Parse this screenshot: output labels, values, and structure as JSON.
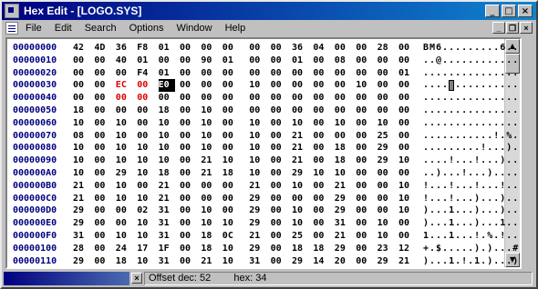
{
  "window": {
    "title": "Hex Edit - [LOGO.SYS]"
  },
  "titlebar_buttons": {
    "minimize": "_",
    "maximize": "□",
    "close": "×"
  },
  "menu": [
    "File",
    "Edit",
    "Search",
    "Options",
    "Window",
    "Help"
  ],
  "mdi_buttons": {
    "minimize": "_",
    "restore": "❐",
    "close": "×"
  },
  "hex_rows": [
    {
      "offset": "00000000",
      "bytes": [
        "42",
        "4D",
        "36",
        "F8",
        "01",
        "00",
        "00",
        "00",
        "00",
        "00",
        "36",
        "04",
        "00",
        "00",
        "28",
        "00"
      ],
      "ascii": "BM6.........6...(."
    },
    {
      "offset": "00000010",
      "bytes": [
        "00",
        "00",
        "40",
        "01",
        "00",
        "00",
        "90",
        "01",
        "00",
        "00",
        "01",
        "00",
        "08",
        "00",
        "00",
        "00"
      ],
      "ascii": "..@............."
    },
    {
      "offset": "00000020",
      "bytes": [
        "00",
        "00",
        "00",
        "F4",
        "01",
        "00",
        "00",
        "00",
        "00",
        "00",
        "00",
        "00",
        "00",
        "00",
        "00",
        "01"
      ],
      "ascii": "................"
    },
    {
      "offset": "00000030",
      "bytes": [
        "00",
        "00",
        "EC",
        "00",
        "E0",
        "00",
        "00",
        "00",
        "10",
        "00",
        "00",
        "00",
        "00",
        "10",
        "00",
        "00"
      ],
      "ascii": "................"
    },
    {
      "offset": "00000040",
      "bytes": [
        "00",
        "00",
        "00",
        "00",
        "00",
        "00",
        "00",
        "00",
        "00",
        "00",
        "00",
        "00",
        "00",
        "00",
        "00",
        "00"
      ],
      "ascii": "................"
    },
    {
      "offset": "00000050",
      "bytes": [
        "18",
        "00",
        "00",
        "00",
        "18",
        "00",
        "10",
        "00",
        "00",
        "00",
        "00",
        "00",
        "00",
        "00",
        "00",
        "00"
      ],
      "ascii": "................"
    },
    {
      "offset": "00000060",
      "bytes": [
        "10",
        "00",
        "10",
        "00",
        "10",
        "00",
        "10",
        "00",
        "10",
        "00",
        "10",
        "00",
        "10",
        "00",
        "10",
        "00"
      ],
      "ascii": "................"
    },
    {
      "offset": "00000070",
      "bytes": [
        "08",
        "00",
        "10",
        "00",
        "10",
        "00",
        "10",
        "00",
        "10",
        "00",
        "21",
        "00",
        "00",
        "00",
        "25",
        "00"
      ],
      "ascii": "...........!.%."
    },
    {
      "offset": "00000080",
      "bytes": [
        "10",
        "00",
        "10",
        "10",
        "10",
        "00",
        "10",
        "00",
        "10",
        "00",
        "21",
        "00",
        "18",
        "00",
        "29",
        "00"
      ],
      "ascii": ".........!...).."
    },
    {
      "offset": "00000090",
      "bytes": [
        "10",
        "00",
        "10",
        "10",
        "10",
        "00",
        "21",
        "10",
        "10",
        "00",
        "21",
        "00",
        "18",
        "00",
        "29",
        "10"
      ],
      "ascii": "....!...!...)..."
    },
    {
      "offset": "000000A0",
      "bytes": [
        "10",
        "00",
        "29",
        "10",
        "18",
        "00",
        "21",
        "18",
        "10",
        "00",
        "29",
        "10",
        "10",
        "00",
        "00",
        "00"
      ],
      "ascii": "..)...!...).....)."
    },
    {
      "offset": "000000B0",
      "bytes": [
        "21",
        "00",
        "10",
        "00",
        "21",
        "00",
        "00",
        "00",
        "21",
        "00",
        "10",
        "00",
        "21",
        "00",
        "00",
        "10"
      ],
      "ascii": "!...!...!...!..."
    },
    {
      "offset": "000000C0",
      "bytes": [
        "21",
        "00",
        "10",
        "10",
        "21",
        "00",
        "00",
        "00",
        "29",
        "00",
        "00",
        "00",
        "29",
        "00",
        "00",
        "10"
      ],
      "ascii": "!...!...)...)..."
    },
    {
      "offset": "000000D0",
      "bytes": [
        "29",
        "00",
        "00",
        "02",
        "31",
        "00",
        "10",
        "00",
        "29",
        "00",
        "10",
        "00",
        "29",
        "00",
        "00",
        "10"
      ],
      "ascii": ")...1...)...)..."
    },
    {
      "offset": "000000E0",
      "bytes": [
        "29",
        "00",
        "00",
        "10",
        "31",
        "00",
        "10",
        "10",
        "29",
        "00",
        "10",
        "00",
        "31",
        "00",
        "10",
        "00"
      ],
      "ascii": ")...1...)...1..."
    },
    {
      "offset": "000000F0",
      "bytes": [
        "31",
        "00",
        "10",
        "10",
        "31",
        "00",
        "18",
        "0C",
        "21",
        "00",
        "25",
        "00",
        "21",
        "00",
        "10",
        "00"
      ],
      "ascii": "1...1...!.%.!..."
    },
    {
      "offset": "00000100",
      "bytes": [
        "28",
        "00",
        "24",
        "17",
        "1F",
        "00",
        "18",
        "10",
        "29",
        "00",
        "18",
        "18",
        "29",
        "00",
        "23",
        "12"
      ],
      "ascii": "+.$.....).)...#."
    },
    {
      "offset": "00000110",
      "bytes": [
        "29",
        "00",
        "18",
        "10",
        "31",
        "00",
        "21",
        "10",
        "31",
        "00",
        "29",
        "14",
        "20",
        "00",
        "29",
        "21"
      ],
      "ascii": ")...1.!.1.)...)!"
    }
  ],
  "status": {
    "offset_text": "Offset dec: 52",
    "hex_text": "hex: 34",
    "close_glyph": "×"
  },
  "colors": {
    "title_start": "#000080",
    "title_end": "#1084d0",
    "offset_color": "#000080",
    "highlight_red": "#e00000"
  },
  "icons": {
    "app": "hex-editor-icon",
    "doc": "document-icon",
    "scroll_up": "arrow-up-icon",
    "scroll_down": "arrow-down-icon"
  }
}
